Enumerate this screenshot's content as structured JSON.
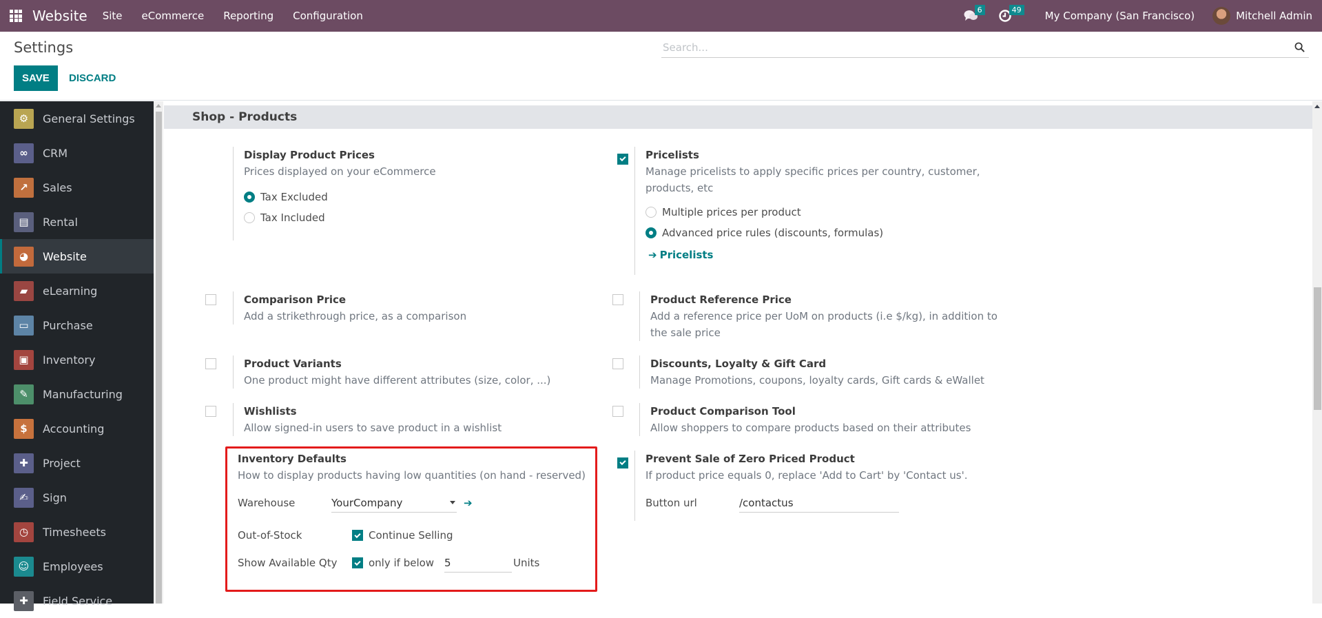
{
  "topbar": {
    "app_name": "Website",
    "menu": [
      "Site",
      "eCommerce",
      "Reporting",
      "Configuration"
    ],
    "messages_count": "6",
    "activities_count": "49",
    "company": "My Company (San Francisco)",
    "user": "Mitchell Admin",
    "icons": {
      "apps": "grid-icon",
      "messages": "chat-icon",
      "activities": "clock-icon"
    }
  },
  "control": {
    "title": "Settings",
    "save_label": "SAVE",
    "discard_label": "DISCARD",
    "search_placeholder": "Search...",
    "search_value": ""
  },
  "sidebar": {
    "items": [
      {
        "label": "General Settings",
        "icon": "gear-icon",
        "color": "#b9a552",
        "glyph": "⚙"
      },
      {
        "label": "CRM",
        "icon": "handshake-icon",
        "color": "#5b5f8a",
        "glyph": "∞"
      },
      {
        "label": "Sales",
        "icon": "chart-icon",
        "color": "#c0703e",
        "glyph": "↗"
      },
      {
        "label": "Rental",
        "icon": "table-icon",
        "color": "#5a5f7d",
        "glyph": "▤"
      },
      {
        "label": "Website",
        "icon": "globe-icon",
        "color": "#c26a3c",
        "glyph": "◕",
        "active": true
      },
      {
        "label": "eLearning",
        "icon": "presentation-icon",
        "color": "#9a4642",
        "glyph": "▰"
      },
      {
        "label": "Purchase",
        "icon": "card-icon",
        "color": "#5d84a6",
        "glyph": "▭"
      },
      {
        "label": "Inventory",
        "icon": "box-icon",
        "color": "#a3453f",
        "glyph": "▣"
      },
      {
        "label": "Manufacturing",
        "icon": "wrench-icon",
        "color": "#4d8f6a",
        "glyph": "✎"
      },
      {
        "label": "Accounting",
        "icon": "invoice-icon",
        "color": "#c7723d",
        "glyph": "$"
      },
      {
        "label": "Project",
        "icon": "puzzle-icon",
        "color": "#5b5f8a",
        "glyph": "✚"
      },
      {
        "label": "Sign",
        "icon": "sign-icon",
        "color": "#5b5f8a",
        "glyph": "✍"
      },
      {
        "label": "Timesheets",
        "icon": "stopwatch-icon",
        "color": "#a3453f",
        "glyph": "◷"
      },
      {
        "label": "Employees",
        "icon": "people-icon",
        "color": "#1b8a8f",
        "glyph": "☺"
      },
      {
        "label": "Field Service",
        "icon": "puzzle-clock-icon",
        "color": "#5c5f66",
        "glyph": "✚"
      }
    ]
  },
  "section": {
    "title": "Shop - Products",
    "settings": {
      "display_prices": {
        "title": "Display Product Prices",
        "desc": "Prices displayed on your eCommerce",
        "options": [
          {
            "label": "Tax Excluded",
            "selected": true
          },
          {
            "label": "Tax Included",
            "selected": false
          }
        ]
      },
      "pricelists": {
        "title": "Pricelists",
        "desc": "Manage pricelists to apply specific prices per country, customer, products, etc",
        "checked": true,
        "options": [
          {
            "label": "Multiple prices per product",
            "selected": false
          },
          {
            "label": "Advanced price rules (discounts, formulas)",
            "selected": true
          }
        ],
        "link_label": "Pricelists"
      },
      "comparison_price": {
        "title": "Comparison Price",
        "desc": "Add a strikethrough price, as a comparison",
        "checked": false
      },
      "reference_price": {
        "title": "Product Reference Price",
        "desc": "Add a reference price per UoM on products (i.e $/kg), in addition to the sale price",
        "checked": false
      },
      "variants": {
        "title": "Product Variants",
        "desc": "One product might have different attributes (size, color, ...)",
        "checked": false
      },
      "loyalty": {
        "title": "Discounts, Loyalty & Gift Card",
        "desc": "Manage Promotions, coupons, loyalty cards, Gift cards & eWallet",
        "checked": false
      },
      "wishlists": {
        "title": "Wishlists",
        "desc": "Allow signed-in users to save product in a wishlist",
        "checked": false
      },
      "comparison_tool": {
        "title": "Product Comparison Tool",
        "desc": "Allow shoppers to compare products based on their attributes",
        "checked": false
      },
      "inventory_defaults": {
        "title": "Inventory Defaults",
        "desc": "How to display products having low quantities (on hand - reserved)",
        "warehouse_label": "Warehouse",
        "warehouse_value": "YourCompany",
        "out_of_stock_label": "Out-of-Stock",
        "continue_selling_label": "Continue Selling",
        "continue_selling_checked": true,
        "show_qty_label": "Show Available Qty",
        "only_if_below_label": "only if below",
        "only_if_below_checked": true,
        "threshold_value": "5",
        "units_label": "Units"
      },
      "zero_priced": {
        "title": "Prevent Sale of Zero Priced Product",
        "desc": "If product price equals 0, replace 'Add to Cart' by 'Contact us'.",
        "checked": true,
        "button_url_label": "Button url",
        "button_url_value": "/contactus"
      }
    }
  },
  "colors": {
    "topbar": "#6c4b62",
    "accent": "#017e84",
    "highlight": "#e31b1b",
    "sidebar": "#212529"
  }
}
